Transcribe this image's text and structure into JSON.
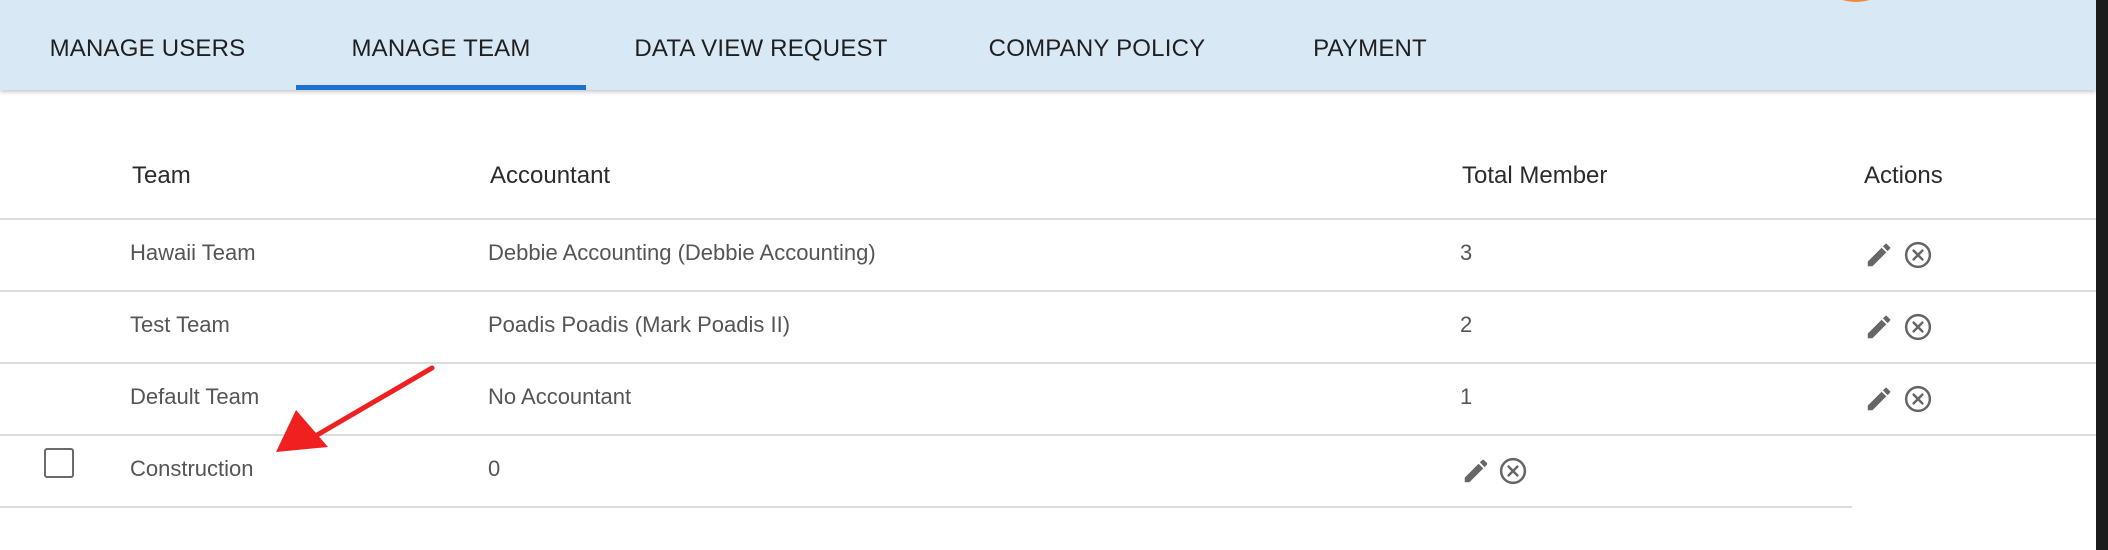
{
  "nav": {
    "tabs": [
      {
        "label": "MANAGE USERS"
      },
      {
        "label": "MANAGE TEAM",
        "active": true
      },
      {
        "label": "DATA VIEW REQUEST"
      },
      {
        "label": "COMPANY POLICY"
      },
      {
        "label": "PAYMENT"
      }
    ],
    "active_color": "#1a73d1",
    "background": "#d9e8f5"
  },
  "table": {
    "headers": {
      "team": "Team",
      "accountant": "Accountant",
      "total_member": "Total Member",
      "actions": "Actions"
    },
    "rows": [
      {
        "team": "Hawaii Team",
        "accountant": "Debbie Accounting (Debbie Accounting)",
        "total_member": "3",
        "actions": [
          "edit-icon",
          "remove-icon"
        ]
      },
      {
        "team": "Test Team",
        "accountant": "Poadis Poadis (Mark Poadis II)",
        "total_member": "2",
        "actions": [
          "edit-icon",
          "remove-icon"
        ]
      },
      {
        "team": "Default Team",
        "accountant": "No Accountant",
        "total_member": "1",
        "actions": [
          "edit-icon",
          "remove-icon"
        ]
      },
      {
        "checkbox_checked": false,
        "team": "Construction",
        "accountant": "0",
        "actions": [
          "edit-icon",
          "remove-icon"
        ]
      }
    ]
  },
  "annotation": {
    "type": "arrow",
    "color": "#f02020",
    "points_to": "Construction"
  }
}
